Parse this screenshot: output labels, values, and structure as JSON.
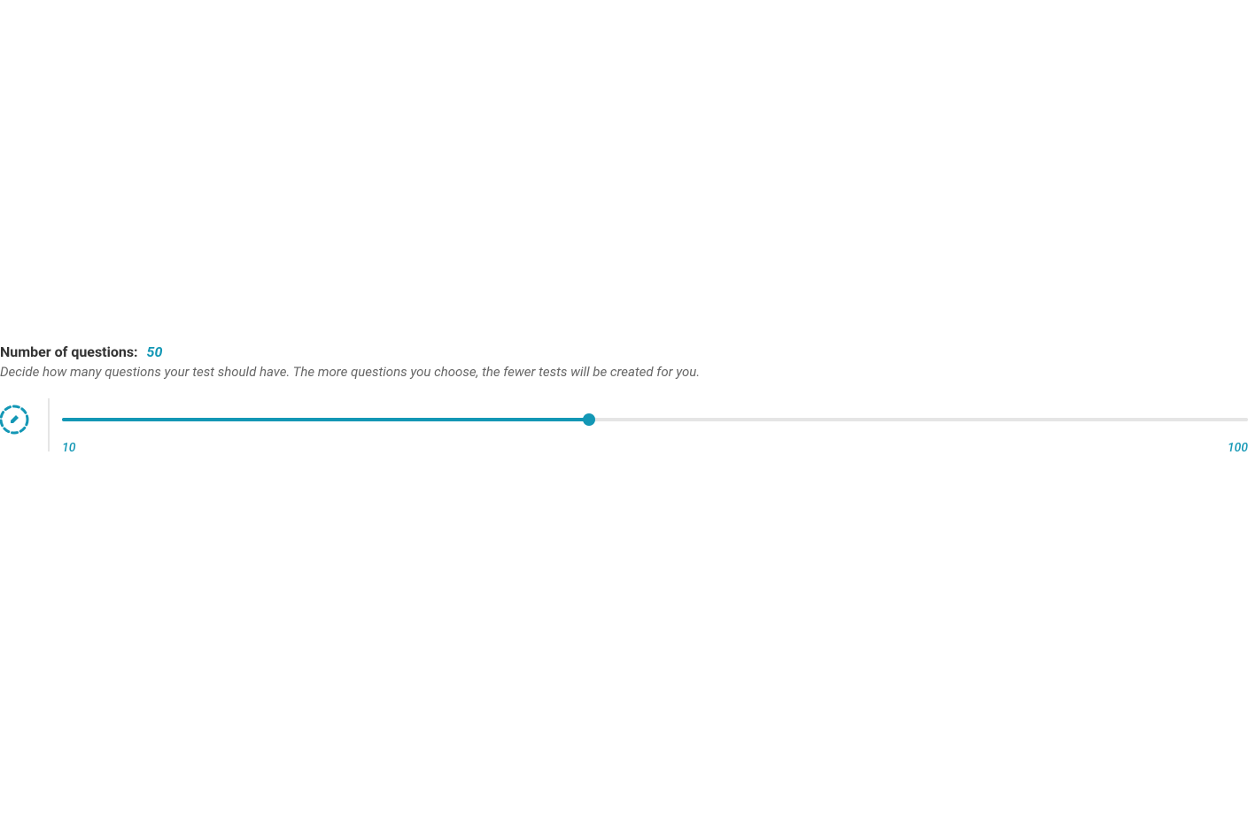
{
  "section": {
    "label": "Number of questions:",
    "value": "50",
    "description": "Decide how many questions your test should have. The more questions you choose, the fewer tests will be created for you."
  },
  "slider": {
    "min": 10,
    "max": 100,
    "current": 50,
    "minLabel": "10",
    "maxLabel": "100"
  },
  "colors": {
    "accent": "#1397b5",
    "textPrimary": "#333333",
    "textSecondary": "#666666",
    "track": "#e5e5e5"
  }
}
